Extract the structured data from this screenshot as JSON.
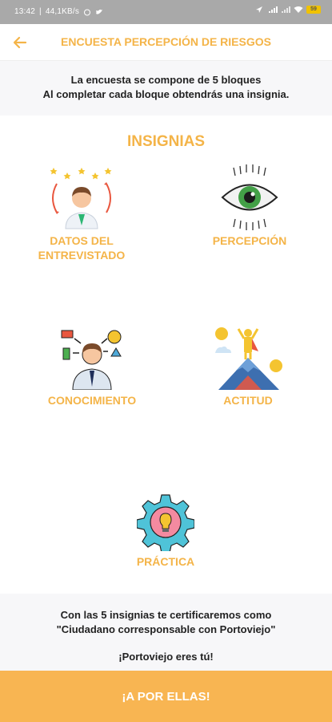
{
  "status_bar": {
    "time": "13:42",
    "net_speed": "44,1KB/s",
    "battery": "59"
  },
  "header": {
    "title": "ENCUESTA PERCEPCIÓN DE RIESGOS",
    "back_icon": "arrow-left-icon"
  },
  "intro": {
    "line1": "La encuesta se compone de 5 bloques",
    "line2": "Al completar cada bloque obtendrás una insignia."
  },
  "badges_section": {
    "title": "INSIGNIAS",
    "items": [
      {
        "label_line1": "DATOS DEL",
        "label_line2": "ENTREVISTADO",
        "icon": "interviewee-person-icon"
      },
      {
        "label_line1": "PERCEPCIÓN",
        "label_line2": "",
        "icon": "eye-icon"
      },
      {
        "label_line1": "CONOCIMIENTO",
        "label_line2": "",
        "icon": "thinking-person-icon"
      },
      {
        "label_line1": "ACTITUD",
        "label_line2": "",
        "icon": "mountain-hero-icon"
      },
      {
        "label_line1": "PRÁCTICA",
        "label_line2": "",
        "icon": "gear-bulb-icon"
      }
    ]
  },
  "footer": {
    "line1": "Con las 5 insignias te certificaremos como",
    "line2": "\"Ciudadano corresponsable con Portoviejo\"",
    "line3": "¡Portoviejo eres tú!"
  },
  "cta": {
    "label": "¡A POR ELLAS!"
  },
  "colors": {
    "accent": "#f4b448",
    "button": "#f8b552",
    "panel": "#f7f7f9"
  }
}
